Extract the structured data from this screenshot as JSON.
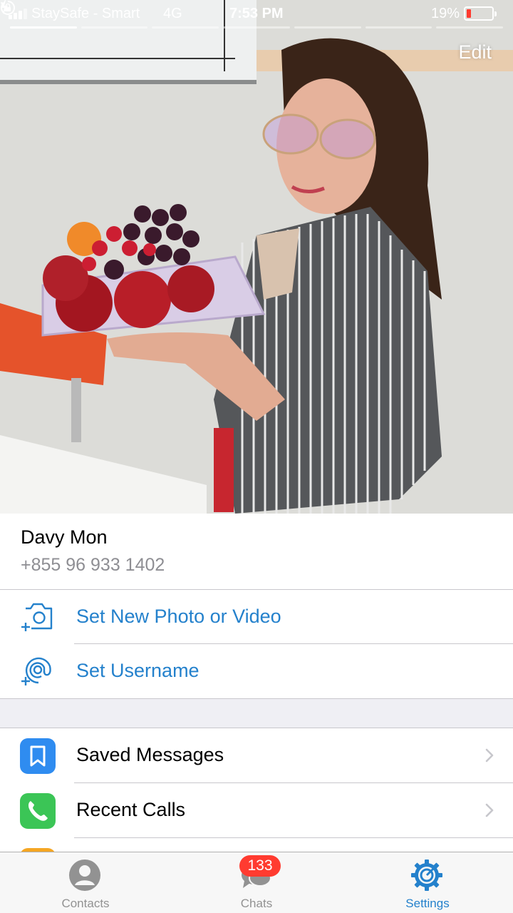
{
  "status_bar": {
    "carrier": "StaySafe - Smart",
    "network": "4G",
    "time": "7:53 PM",
    "battery_percent": "19%",
    "battery_level": 0.19,
    "battery_color": "#ff3b30",
    "icons": [
      "signal-icon",
      "rotation-lock-icon",
      "battery-icon",
      "charging-bolt-icon"
    ]
  },
  "header": {
    "edit_label": "Edit",
    "story_segments": 7,
    "active_segment": 1
  },
  "profile": {
    "name": "Davy Mon",
    "phone": "+855 96 933 1402"
  },
  "actions": [
    {
      "label": "Set New Photo or Video",
      "icon": "camera-add-icon"
    },
    {
      "label": "Set Username",
      "icon": "at-sign-add-icon"
    }
  ],
  "settings": [
    {
      "label": "Saved Messages",
      "icon": "bookmark-icon",
      "color": "#2f8cf0"
    },
    {
      "label": "Recent Calls",
      "icon": "phone-icon",
      "color": "#3bc556"
    }
  ],
  "tab_bar": {
    "tabs": [
      {
        "label": "Contacts",
        "icon": "person-icon",
        "active": false
      },
      {
        "label": "Chats",
        "icon": "chat-bubbles-icon",
        "active": false,
        "badge": "133"
      },
      {
        "label": "Settings",
        "icon": "gear-icon",
        "active": true
      }
    ]
  },
  "colors": {
    "accent": "#2481cc",
    "badge": "#ff3b30",
    "secondary_text": "#8e8e93"
  }
}
